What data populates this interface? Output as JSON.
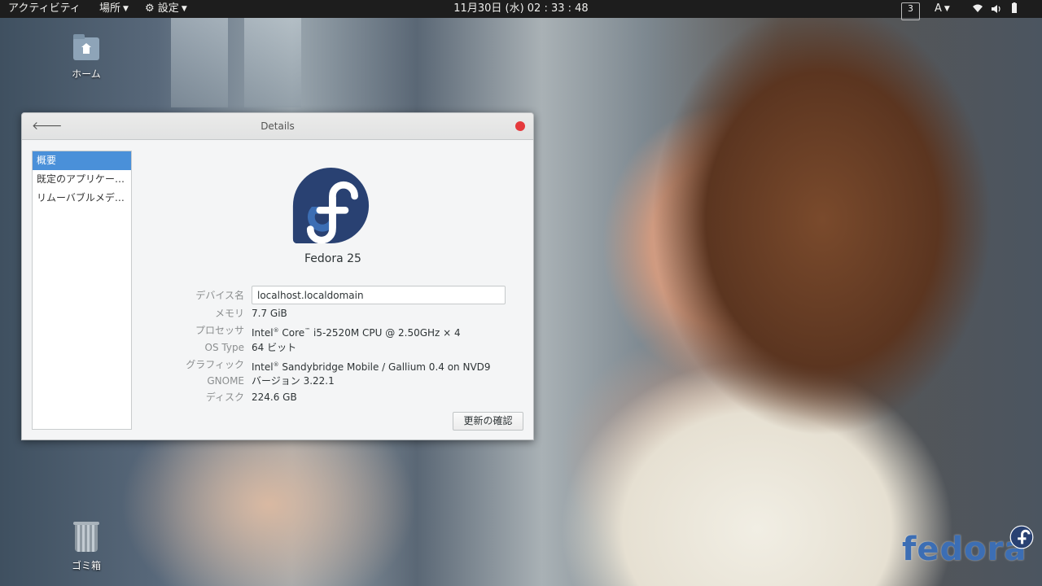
{
  "topbar": {
    "activities": "アクティビティ",
    "places": "場所",
    "settings": "設定",
    "clock": "11月30日 (水) 02 : 33 : 48",
    "workspace": "3",
    "input_method": "A"
  },
  "desktop": {
    "home_label": "ホーム",
    "trash_label": "ゴミ箱"
  },
  "dialog": {
    "title": "Details",
    "sidebar": [
      "概要",
      "既定のアプリケー…",
      "リムーバブルメデ…"
    ],
    "os_name": "Fedora 25",
    "device_name_label": "デバイス名",
    "device_name_value": "localhost.localdomain",
    "memory_label": "メモリ",
    "memory_value": "7.7 GiB",
    "processor_label": "プロセッサ",
    "processor_intel": "Intel",
    "processor_core": " Core",
    "processor_rest": " i5-2520M CPU @ 2.50GHz × 4",
    "ostype_label": "OS Type",
    "ostype_value": "64 ビット",
    "graphics_label": "グラフィック",
    "graphics_intel": "Intel",
    "graphics_rest": " Sandybridge Mobile  / Gallium 0.4 on NVD9",
    "gnome_label": "GNOME",
    "gnome_value": "バージョン 3.22.1",
    "disk_label": "ディスク",
    "disk_value": "224.6 GB",
    "update_button": "更新の確認"
  },
  "watermark": "fedora",
  "colors": {
    "accent": "#4a90d9",
    "close": "#e5393c",
    "fedora_blue": "#294172",
    "fedora_light": "#3c6eb4"
  }
}
